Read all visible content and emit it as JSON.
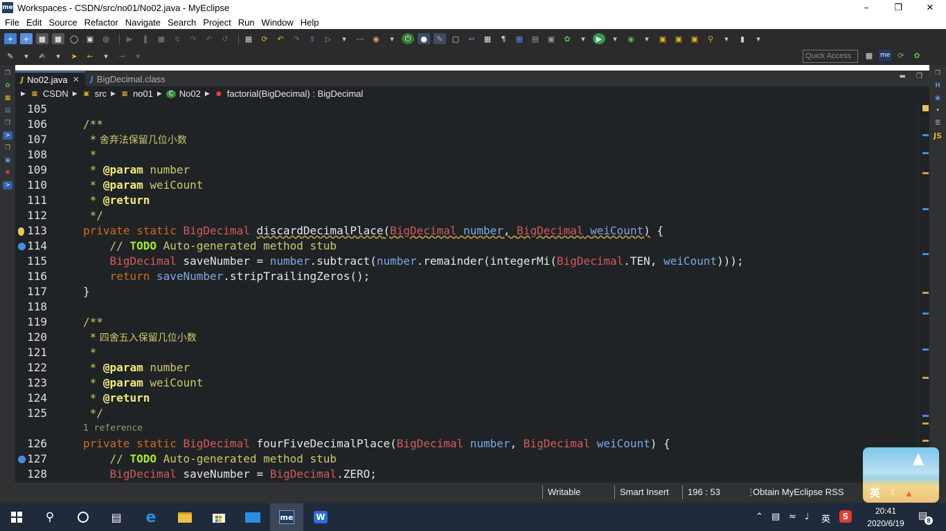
{
  "window": {
    "title": "Workspaces - CSDN/src/no01/No02.java - MyEclipse",
    "app_icon_label": "me",
    "controls": [
      "minimize-icon",
      "maximize-icon",
      "close-icon"
    ]
  },
  "menu": [
    "File",
    "Edit",
    "Source",
    "Refactor",
    "Navigate",
    "Search",
    "Project",
    "Run",
    "Window",
    "Help"
  ],
  "toolbar": {
    "quick_access_placeholder": "Quick Access"
  },
  "tabs": [
    {
      "label": "No02.java",
      "active": true
    },
    {
      "label": "BigDecimal.class",
      "active": false
    }
  ],
  "breadcrumb": [
    "CSDN",
    "src",
    "no01",
    "No02",
    "factorial(BigDecimal) : BigDecimal"
  ],
  "code": {
    "lines": [
      {
        "num": "105"
      },
      {
        "num": "106"
      },
      {
        "num": "107"
      },
      {
        "num": "108"
      },
      {
        "num": "109"
      },
      {
        "num": "110"
      },
      {
        "num": "111"
      },
      {
        "num": "112"
      },
      {
        "num": "113"
      },
      {
        "num": "114"
      },
      {
        "num": "115"
      },
      {
        "num": "116"
      },
      {
        "num": "117"
      },
      {
        "num": "118"
      },
      {
        "num": "119"
      },
      {
        "num": "120"
      },
      {
        "num": "121"
      },
      {
        "num": "122"
      },
      {
        "num": "123"
      },
      {
        "num": "124"
      },
      {
        "num": "125"
      },
      {
        "num": "126"
      },
      {
        "num": "127"
      },
      {
        "num": "128"
      }
    ],
    "tokens": {
      "open_doc": "/**",
      "close_doc": " */",
      "star": " *",
      "c107": " 舍弃法保留几位小数",
      "c120": " 四舍五入保留几位小数",
      "param": "@param",
      "return_tag": "@return",
      "p_number": "number",
      "p_weiCount": "weiCount",
      "private_static": "private static",
      "BigDecimal": "BigDecimal",
      "discardDecimalPlace": "discardDecimalPlace",
      "fourFiveDecimalPlace": "fourFiveDecimalPlace",
      "todo_prefix": "// ",
      "todo": "TODO",
      "todo_rest": " Auto-generated method stub",
      "saveNumber": "saveNumber",
      "assign": " = ",
      "subtract": ".subtract(",
      "remainder": ".remainder(",
      "integerMi": "integerMi(",
      "TEN": ".TEN, ",
      "end115": ")));",
      "return_kw": "return",
      "stripTrailingZeros": ".stripTrailingZeros();",
      "close_brace": "}",
      "open_brace": " {",
      "comma": ", ",
      "paren_open": "(",
      "paren_close": ")",
      "ZERO": ".ZERO;",
      "reference": "1 reference"
    }
  },
  "status": {
    "writable": "Writable",
    "insert_mode": "Smart Insert",
    "position": "196 : 53",
    "rss": "Obtain MyEclipse RSS"
  },
  "popup": {
    "text": "英"
  },
  "taskbar": {
    "tray_lang": "英",
    "time": "20:41",
    "date": "2020/6/19",
    "notification_count": "8"
  },
  "colors": {
    "editor_bg": "#1f2326",
    "comment": "#cfc96a",
    "keyword": "#cc6c1d",
    "type": "#d55b5b",
    "param": "#7ea8e6",
    "todo": "#a7ec21"
  }
}
